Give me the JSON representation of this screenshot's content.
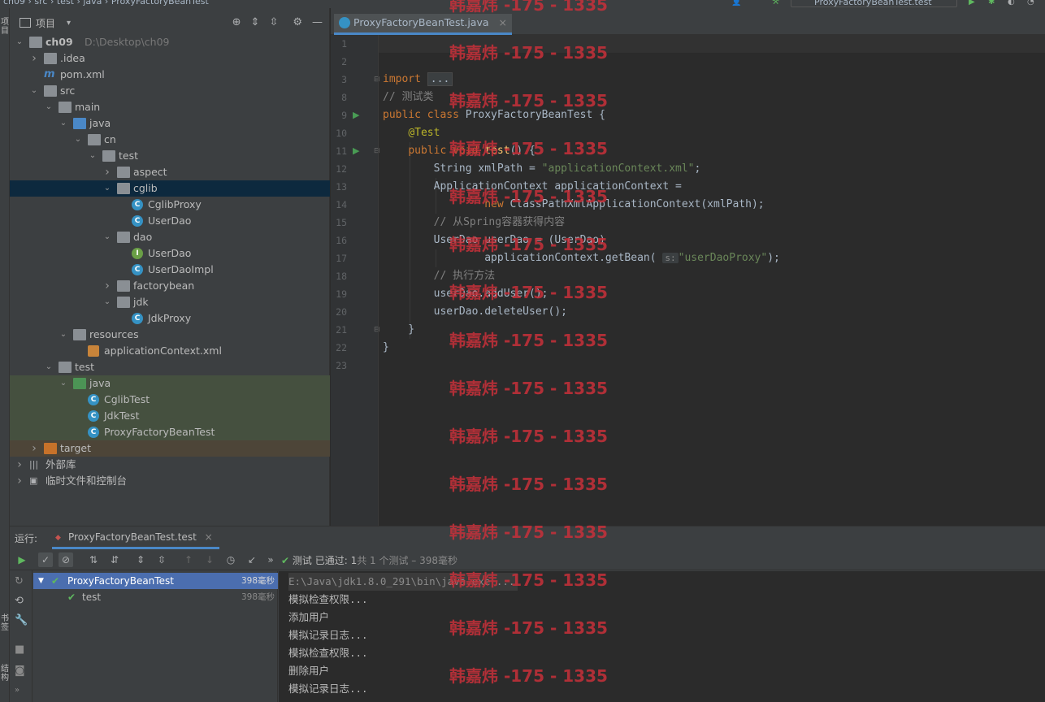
{
  "topbar": {
    "breadcrumb": "ch09 › src › test › java › ProxyFactoryBeanTest",
    "run_config": "ProxyFactoryBeanTest.test"
  },
  "left_stripe": {
    "label_top": "项目",
    "label_mid": "书签",
    "label_bottom": "结构"
  },
  "project": {
    "title": "项目",
    "tree": [
      {
        "label": "ch09",
        "hint": "D:\\Desktop\\ch09",
        "depth": 0,
        "arrow": "open",
        "icon": "folder",
        "bold": true
      },
      {
        "label": ".idea",
        "depth": 1,
        "arrow": "closed",
        "icon": "folder"
      },
      {
        "label": "pom.xml",
        "depth": 1,
        "arrow": "none",
        "icon": "maven"
      },
      {
        "label": "src",
        "depth": 1,
        "arrow": "open",
        "icon": "folder"
      },
      {
        "label": "main",
        "depth": 2,
        "arrow": "open",
        "icon": "folder"
      },
      {
        "label": "java",
        "depth": 3,
        "arrow": "open",
        "icon": "folder-blue"
      },
      {
        "label": "cn",
        "depth": 4,
        "arrow": "open",
        "icon": "package"
      },
      {
        "label": "test",
        "depth": 5,
        "arrow": "open",
        "icon": "package"
      },
      {
        "label": "aspect",
        "depth": 6,
        "arrow": "closed",
        "icon": "package"
      },
      {
        "label": "cglib",
        "depth": 6,
        "arrow": "open",
        "icon": "package",
        "selected": true
      },
      {
        "label": "CglibProxy",
        "depth": 7,
        "arrow": "none",
        "icon": "class"
      },
      {
        "label": "UserDao",
        "depth": 7,
        "arrow": "none",
        "icon": "class"
      },
      {
        "label": "dao",
        "depth": 6,
        "arrow": "open",
        "icon": "package"
      },
      {
        "label": "UserDao",
        "depth": 7,
        "arrow": "none",
        "icon": "interface"
      },
      {
        "label": "UserDaoImpl",
        "depth": 7,
        "arrow": "none",
        "icon": "class"
      },
      {
        "label": "factorybean",
        "depth": 6,
        "arrow": "closed",
        "icon": "package"
      },
      {
        "label": "jdk",
        "depth": 6,
        "arrow": "open",
        "icon": "package"
      },
      {
        "label": "JdkProxy",
        "depth": 7,
        "arrow": "none",
        "icon": "class"
      },
      {
        "label": "resources",
        "depth": 3,
        "arrow": "open",
        "icon": "folder-res"
      },
      {
        "label": "applicationContext.xml",
        "depth": 4,
        "arrow": "none",
        "icon": "xml"
      },
      {
        "label": "test",
        "depth": 2,
        "arrow": "open",
        "icon": "folder"
      },
      {
        "label": "java",
        "depth": 3,
        "arrow": "open",
        "icon": "folder-green",
        "highlight": "green"
      },
      {
        "label": "CglibTest",
        "depth": 4,
        "arrow": "none",
        "icon": "test-class",
        "highlight": "green"
      },
      {
        "label": "JdkTest",
        "depth": 4,
        "arrow": "none",
        "icon": "test-class",
        "highlight": "green"
      },
      {
        "label": "ProxyFactoryBeanTest",
        "depth": 4,
        "arrow": "none",
        "icon": "test-class",
        "highlight": "green"
      },
      {
        "label": "target",
        "depth": 1,
        "arrow": "closed",
        "icon": "folder-orange",
        "highlight": "orange"
      },
      {
        "label": "外部库",
        "depth": 0,
        "arrow": "closed",
        "icon": "library"
      },
      {
        "label": "临时文件和控制台",
        "depth": 0,
        "arrow": "closed",
        "icon": "scratch"
      }
    ]
  },
  "editor": {
    "tab_label": "ProxyFactoryBeanTest.java",
    "line_numbers": [
      "1",
      "2",
      "3",
      "8",
      "9",
      "10",
      "11",
      "12",
      "13",
      "14",
      "15",
      "16",
      "17",
      "18",
      "19",
      "20",
      "21",
      "22",
      "23"
    ],
    "param_hint": "s:"
  },
  "watermark": "韩嘉炜 -175 - 1335",
  "run": {
    "label": "运行:",
    "tab": "ProxyFactoryBeanTest.test",
    "status_main": "测试 已通过: 1",
    "status_sub": "共 1 个测试 – 398毫秒",
    "tests": [
      {
        "name": "ProxyFactoryBeanTest",
        "time": "398毫秒"
      },
      {
        "name": "test",
        "time": "398毫秒"
      }
    ],
    "console": [
      "E:\\Java\\jdk1.8.0_291\\bin\\java.exe ...",
      "模拟检查权限...",
      "添加用户",
      "模拟记录日志...",
      "模拟检查权限...",
      "删除用户",
      "模拟记录日志..."
    ]
  }
}
